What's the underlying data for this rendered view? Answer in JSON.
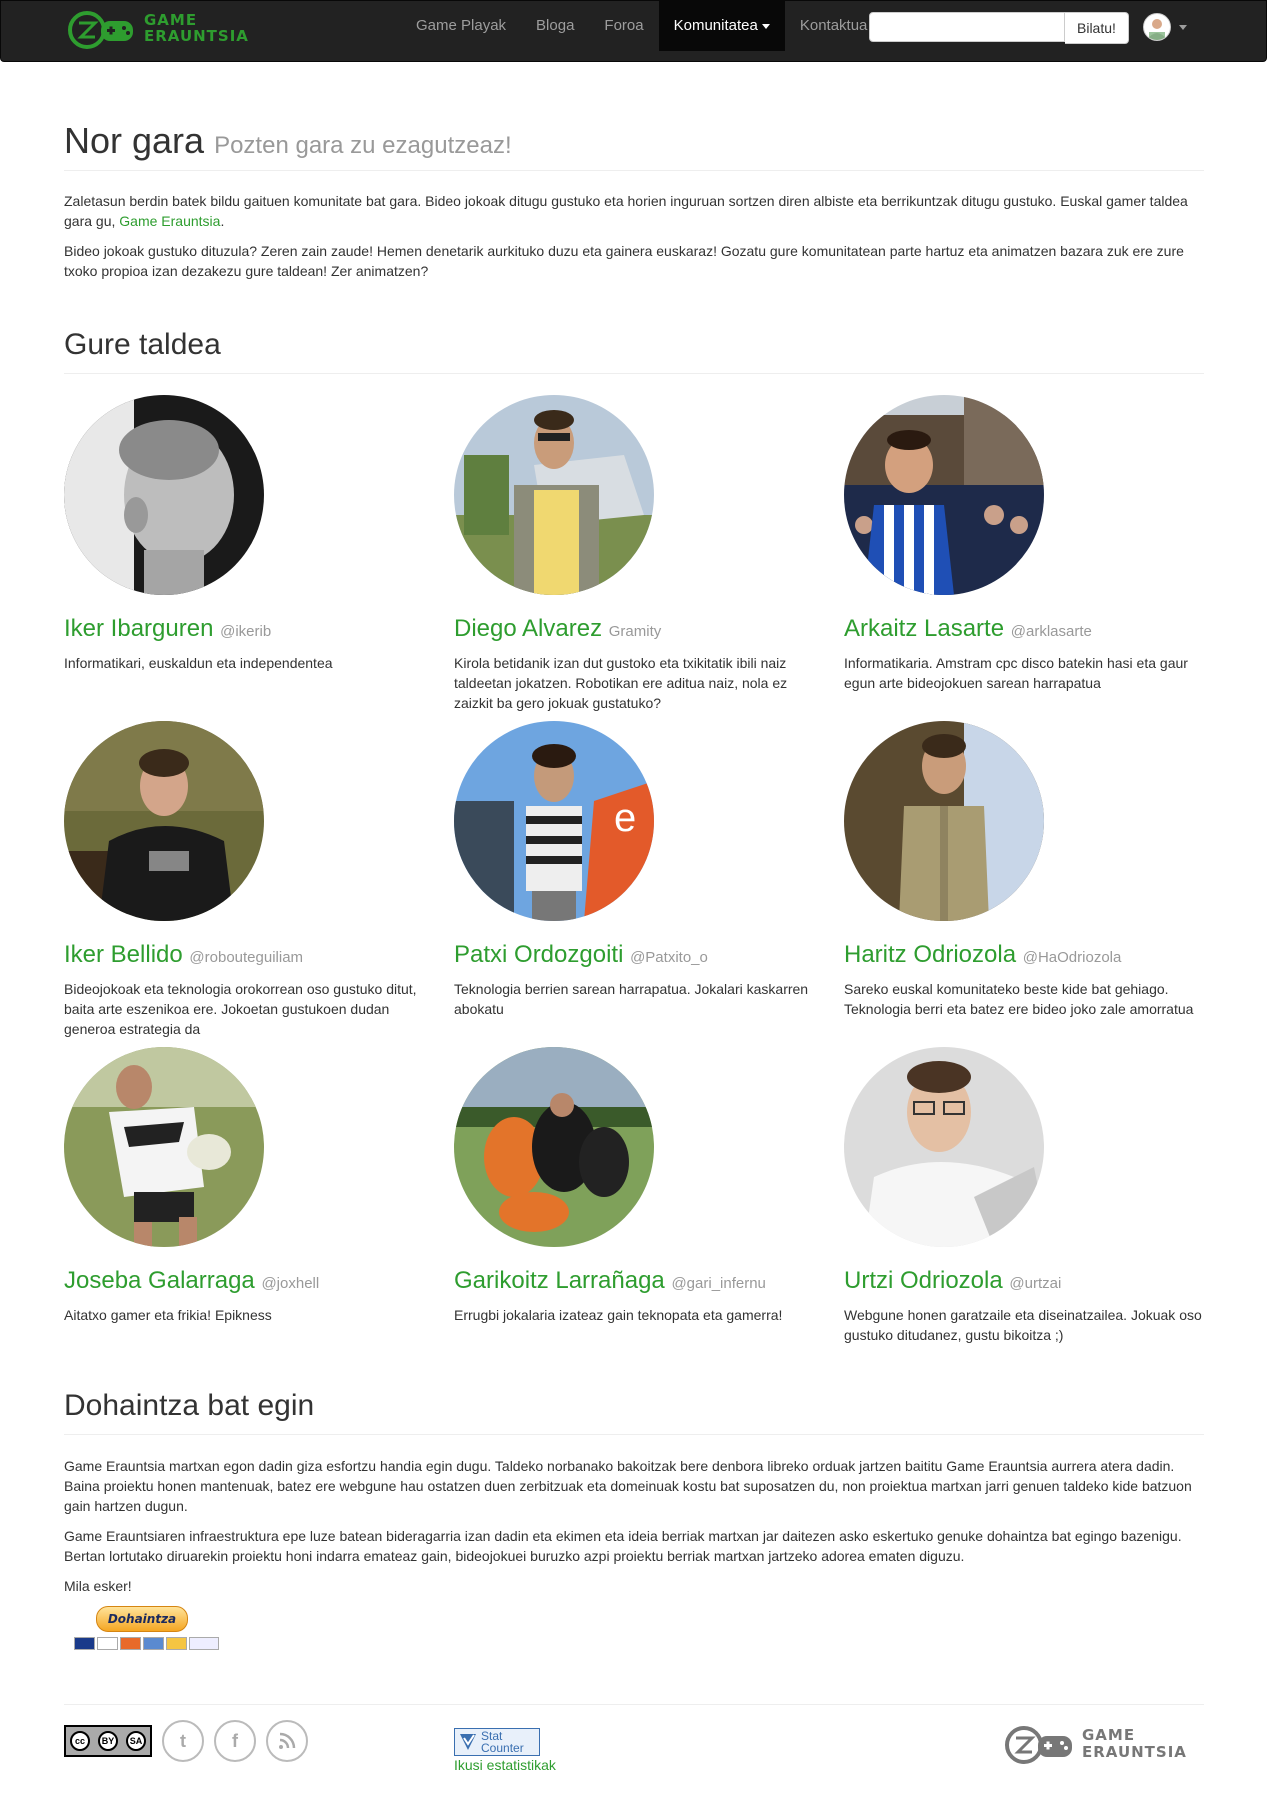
{
  "navbar": {
    "brand_line1": "GAME",
    "brand_line2": "ERAUNTSIA",
    "links": [
      "Game Playak",
      "Bloga",
      "Foroa",
      "Komunitatea",
      "Kontaktua"
    ],
    "active_link": "Komunitatea",
    "search_placeholder": "",
    "search_button": "Bilatu!"
  },
  "header": {
    "title": "Nor gara",
    "subtitle": "Pozten gara zu ezagutzeaz!"
  },
  "intro": {
    "p1_text": "Zaletasun berdin batek bildu gaituen komunitate bat gara. Bideo jokoak ditugu gustuko eta horien inguruan sortzen diren albiste eta berrikuntzak ditugu gustuko. Euskal gamer taldea gara gu, ",
    "p1_link": "Game Erauntsia",
    "p1_end": ".",
    "p2": "Bideo jokoak gustuko dituzula? Zeren zain zaude! Hemen denetarik aurkituko duzu eta gainera euskaraz! Gozatu gure komunitatean parte hartuz eta animatzen bazara zuk ere zure txoko propioa izan dezakezu gure taldean! Zer animatzen?"
  },
  "team": {
    "heading": "Gure taldea",
    "members": [
      {
        "name": "Iker Ibarguren",
        "handle": "@ikerib",
        "desc": "Informatikari, euskaldun eta independentea"
      },
      {
        "name": "Diego Alvarez",
        "handle": "Gramity",
        "desc": "Kirola betidanik izan dut gustoko eta txikitatik ibili naiz taldeetan jokatzen. Robotikan ere aditua naiz, nola ez zaizkit ba gero jokuak gustatuko?"
      },
      {
        "name": "Arkaitz Lasarte",
        "handle": "@arklasarte",
        "desc": "Informatikaria. Amstram cpc disco batekin hasi eta gaur egun arte bideojokuen sarean harrapatua"
      },
      {
        "name": "Iker Bellido",
        "handle": "@robouteguiliam",
        "desc": "Bideojokoak eta teknologia orokorrean oso gustuko ditut, baita arte eszenikoa ere. Jokoetan gustukoen dudan generoa estrategia da"
      },
      {
        "name": "Patxi Ordozgoiti",
        "handle": "@Patxito_o",
        "desc": "Teknologia berrien sarean harrapatua. Jokalari kaskarren abokatu"
      },
      {
        "name": "Haritz Odriozola",
        "handle": "@HaOdriozola",
        "desc": "Sareko euskal komunitateko beste kide bat gehiago. Teknologia berri eta batez ere bideo joko zale amorratua"
      },
      {
        "name": "Joseba Galarraga",
        "handle": "@joxhell",
        "desc": "Aitatxo gamer eta frikia! Epikness"
      },
      {
        "name": "Garikoitz Larrañaga",
        "handle": "@gari_infernu",
        "desc": "Errugbi jokalaria izateaz gain teknopata eta gamerra!"
      },
      {
        "name": "Urtzi Odriozola",
        "handle": "@urtzai",
        "desc": "Webgune honen garatzaile eta diseinatzailea. Jokuak oso gustuko ditudanez, gustu bikoitza ;)"
      }
    ]
  },
  "donation": {
    "heading": "Dohaintza bat egin",
    "p1": "Game Erauntsia martxan egon dadin giza esfortzu handia egin dugu. Taldeko norbanako bakoitzak bere denbora libreko orduak jartzen baititu Game Erauntsia aurrera atera dadin. Baina proiektu honen mantenuak, batez ere webgune hau ostatzen duen zerbitzuak eta domeinuak kostu bat suposatzen du, non proiektua martxan jarri genuen taldeko kide batzuon gain hartzen dugun.",
    "p2": "Game Erauntsiaren infraestruktura epe luze batean bideragarria izan dadin eta ekimen eta ideia berriak martxan jar daitezen asko eskertuko genuke dohaintza bat egingo bazenigu. Bertan lortutako diruarekin proiektu honi indarra emateaz gain, bideojokuei buruzko azpi proiektu berriak martxan jartzeko adorea ematen diguzu.",
    "p3": "Mila esker!",
    "button": "Dohaintza"
  },
  "footer": {
    "cc_by": "BY",
    "cc_sa": "SA",
    "statcounter_line1": "Stat",
    "statcounter_line2": "Counter",
    "stats_link": "Ikusi estatistikak",
    "brand_line1": "GAME",
    "brand_line2": "ERAUNTSIA"
  },
  "colors": {
    "accent": "#2e9d2f",
    "navbar": "#222222",
    "muted": "#999999"
  }
}
